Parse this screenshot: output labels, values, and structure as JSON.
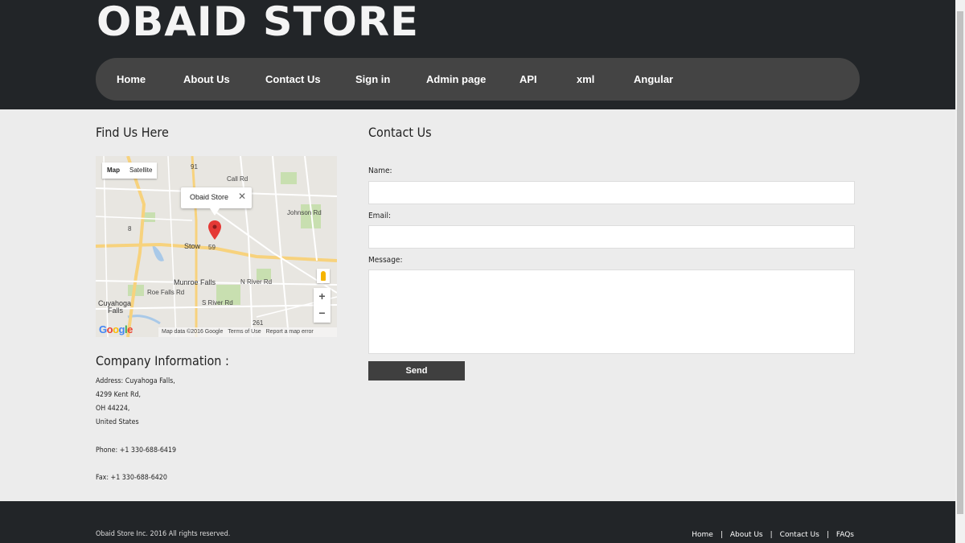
{
  "header": {
    "logo": "OBAID STORE",
    "nav": [
      "Home",
      "About Us",
      "Contact Us",
      "Sign in",
      "Admin page",
      "API",
      "xml",
      "Angular"
    ]
  },
  "find_us": {
    "title": "Find Us Here",
    "map": {
      "type_map": "Map",
      "type_satellite": "Satellite",
      "info_title": "Obaid Store",
      "close_glyph": "✕",
      "zoom_in": "+",
      "zoom_out": "−",
      "google": "Google",
      "data_text": "Map data ©2016 Google",
      "terms_text": "Terms of Use",
      "report_text": "Report a map error",
      "labels": {
        "stow": "Stow",
        "munroe": "Munroe Falls",
        "cuyahoga1": "Cuyahoga",
        "cuyahoga2": "Falls",
        "johnson": "Johnson Rd",
        "nriver": "N River Rd",
        "sriver": "S River Rd",
        "call": "Call Rd",
        "roefalls": "Roe Falls Rd",
        "route59": "59",
        "route91": "91",
        "route8": "8",
        "route261": "261"
      }
    }
  },
  "company": {
    "title": "Company Information :",
    "address1": "Address: Cuyahoga Falls,",
    "address2": "4299 Kent Rd,",
    "address3": "OH 44224,",
    "address4": "United States",
    "phone": "Phone: +1 330-688-6419",
    "fax": "Fax: +1 330-688-6420"
  },
  "contact": {
    "title": "Contact Us",
    "name_label": "Name:",
    "email_label": "Email:",
    "message_label": "Message:",
    "name_value": "",
    "email_value": "",
    "message_value": "",
    "send_label": "Send"
  },
  "footer": {
    "copyright": "Obaid Store Inc. 2016 All rights reserved.",
    "links": [
      "Home",
      "About Us",
      "Contact Us",
      "FAQs"
    ],
    "separator": "|"
  },
  "colors": {
    "header_bg": "#222528",
    "nav_bg": "#444444",
    "page_bg": "#ececec",
    "marker": "#e53935"
  }
}
